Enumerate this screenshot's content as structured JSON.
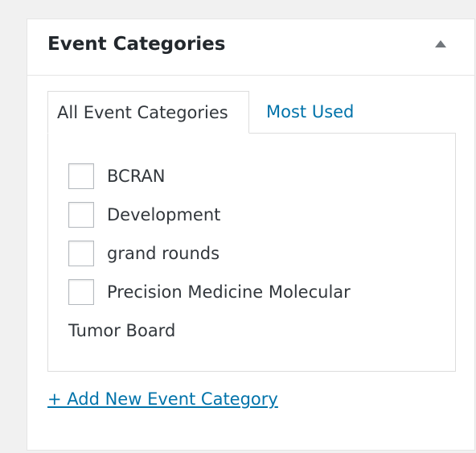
{
  "metabox": {
    "title": "Event Categories"
  },
  "tabs": [
    {
      "label": "All Event Categories",
      "active": true
    },
    {
      "label": "Most Used",
      "active": false
    }
  ],
  "categories": [
    {
      "label": "BCRAN",
      "checked": false
    },
    {
      "label": "Development",
      "checked": false
    },
    {
      "label": "grand rounds",
      "checked": false
    },
    {
      "label": "Precision Medicine Molecular",
      "checked": false
    }
  ],
  "category_label_continuation": "Tumor Board",
  "add_new": {
    "label": "+ Add New Event Category"
  },
  "colors": {
    "link": "#0073aa",
    "text": "#32373c",
    "title": "#23282d",
    "border": "#dddddd",
    "page_background": "#f1f1f1"
  },
  "icons": {
    "toggle": "triangle-up-icon"
  }
}
